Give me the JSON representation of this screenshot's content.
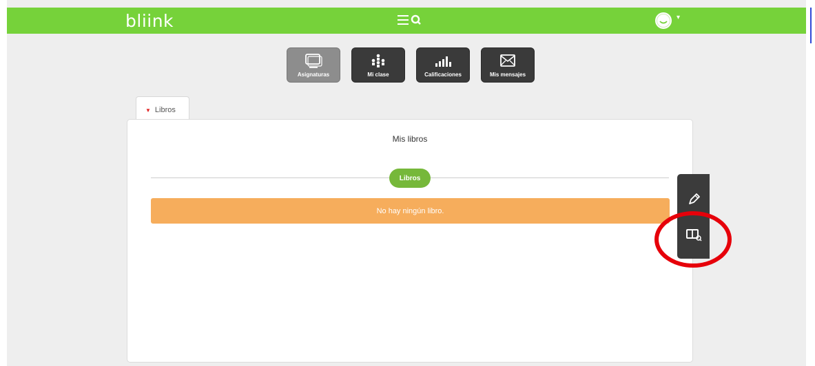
{
  "app": {
    "logo_text": "bliink",
    "brand_color": "#76d23a"
  },
  "header": {
    "menu_icon": "hamburger-icon",
    "search_icon": "search-icon",
    "avatar_icon": "smiley-avatar-icon",
    "avatar_caret": "▾"
  },
  "nav": {
    "buttons": [
      {
        "label": "Asignaturas",
        "icon": "screens-icon",
        "active": true
      },
      {
        "label": "Mi clase",
        "icon": "people-icon",
        "active": false
      },
      {
        "label": "Calificaciones",
        "icon": "bars-icon",
        "active": false
      },
      {
        "label": "Mis mensajes",
        "icon": "envelope-icon",
        "active": false
      }
    ]
  },
  "tab": {
    "label": "Libros",
    "arrow": "▼"
  },
  "card": {
    "title": "Mis libros",
    "section_label": "Libros",
    "empty_message": "No hay ningún libro."
  },
  "sidetools": [
    {
      "icon": "pencil-icon"
    },
    {
      "icon": "book-settings-icon"
    }
  ],
  "colors": {
    "notice": "#f6ad5c",
    "pill": "#76b83a",
    "annotation": "#e6000a"
  }
}
